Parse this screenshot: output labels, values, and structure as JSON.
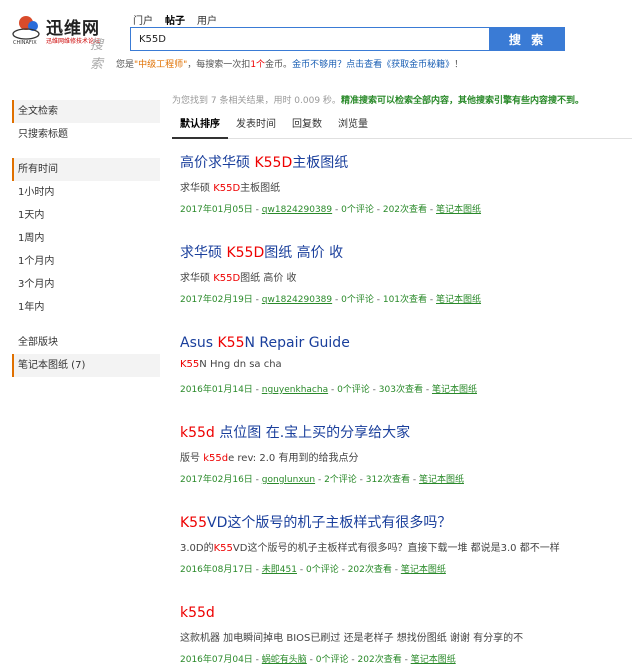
{
  "logo": {
    "name": "迅维网",
    "sub": "迅维网维修技术论坛",
    "search_word": "搜索",
    "mark_text": "CHINAFIX"
  },
  "search": {
    "tabs": [
      "门户",
      "帖子",
      "用户"
    ],
    "active_tab": "帖子",
    "query": "K55D",
    "button": "搜 索"
  },
  "notice": {
    "prefix": "您是",
    "level": "\"中级工程师\"",
    "mid": "，每搜索一次扣",
    "cost": "1个",
    "mid2": "金币。",
    "link1": "金币不够用？",
    "link2": "点击查看《获取金币秘籍》",
    "suffix": "！"
  },
  "sidebar": {
    "group1": [
      "全文检索",
      "只搜索标题"
    ],
    "group2": [
      "所有时间",
      "1小时内",
      "1天内",
      "1周内",
      "1个月内",
      "3个月内",
      "1年内"
    ],
    "group3": [
      "全部版块",
      "笔记本图纸 (7)"
    ]
  },
  "stats": {
    "text": "为您找到 7 条相关结果，用时 0.009 秒。",
    "highlight": "精准搜索可以检索全部内容，其他搜索引擎有些内容搜不到。"
  },
  "sort_tabs": [
    "默认排序",
    "发表时间",
    "回复数",
    "浏览量"
  ],
  "results": [
    {
      "title_pre": "高价求华硕 ",
      "title_hl": "K55D",
      "title_post": "主板图纸",
      "snip_pre": "求华硕 ",
      "snip_hl": "K55D",
      "snip_post": "主板图纸",
      "date": "2017年01月05日",
      "author": "qw1824290389",
      "replies": "0个评论",
      "views": "202次查看",
      "forum": "笔记本图纸"
    },
    {
      "title_pre": "求华硕 ",
      "title_hl": "K55D",
      "title_post": "图纸 高价 收",
      "snip_pre": "求华硕 ",
      "snip_hl": "K55D",
      "snip_post": "图纸 高价 收",
      "date": "2017年02月19日",
      "author": "qw1824290389",
      "replies": "0个评论",
      "views": "101次查看",
      "forum": "笔记本图纸"
    },
    {
      "title_pre": "Asus ",
      "title_hl": "K55",
      "title_post": "N Repair Guide",
      "snip_pre": "",
      "snip_hl": "K55",
      "snip_post": "N Hng dn sa cha",
      "date": "2016年01月14日",
      "author": "nguyenkhacha",
      "replies": "0个评论",
      "views": "303次查看",
      "forum": "笔记本图纸"
    },
    {
      "title_pre": "",
      "title_hl": "k55d",
      "title_post": " 点位图 在.宝上买的分享给大家",
      "snip_pre": "版号 ",
      "snip_hl": "k55d",
      "snip_post": "e rev: 2.0 有用到的给我点分",
      "date": "2017年02月16日",
      "author": "gonglunxun",
      "replies": "2个评论",
      "views": "312次查看",
      "forum": "笔记本图纸"
    },
    {
      "title_pre": "",
      "title_hl": "K55",
      "title_post": "VD这个版号的机子主板样式有很多吗？",
      "snip_pre": "3.0D的",
      "snip_hl": "K55",
      "snip_post": "VD这个版号的机子主板样式有很多吗？直接下载一堆 都说是3.0 都不一样",
      "date": "2016年08月17日",
      "author": "未即451",
      "replies": "0个评论",
      "views": "202次查看",
      "forum": "笔记本图纸"
    },
    {
      "title_pre": "",
      "title_hl": "k55d",
      "title_post": "",
      "snip_pre": "",
      "snip_hl": "",
      "snip_post": "这款机器 加电瞬间掉电 BIOS已刷过 还是老样子 想找份图纸 谢谢 有分享的不",
      "date": "2016年07月04日",
      "author": "蜗蛇有头脑",
      "replies": "0个评论",
      "views": "202次查看",
      "forum": "笔记本图纸"
    }
  ],
  "colors": {
    "accent_blue": "#3a7bd5",
    "link_blue": "#1a3f9c",
    "highlight_red": "#e00000",
    "meta_green": "#2a8a2a",
    "warn_orange": "#e07000"
  }
}
